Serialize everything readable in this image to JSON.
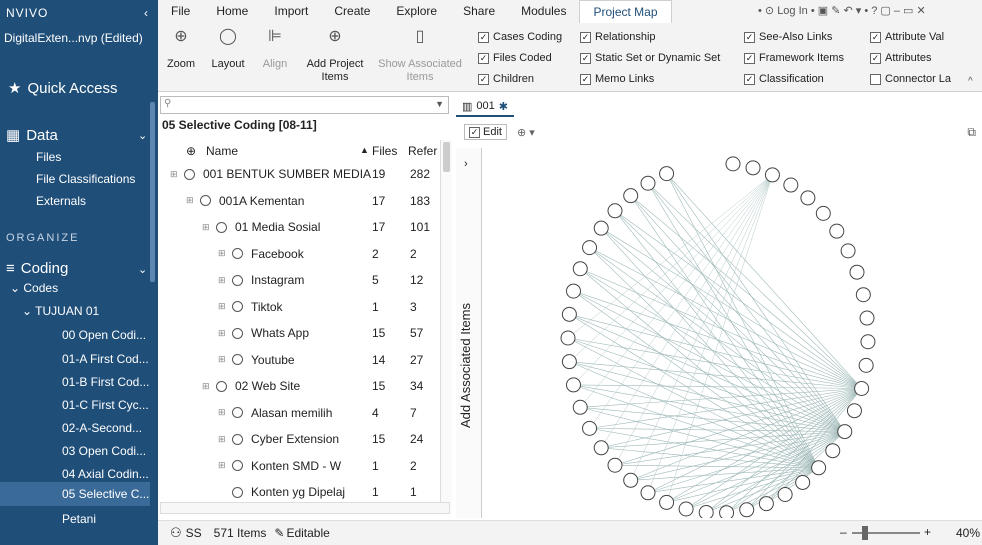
{
  "sidebar": {
    "logo": "NVIVO",
    "project": "DigitalExten...nvp (Edited)",
    "quick_access": "Quick Access",
    "data_header": "Data",
    "data_items": [
      "Files",
      "File Classifications",
      "Externals"
    ],
    "organize_label": "ORGANIZE",
    "coding_header": "Coding",
    "codes_label": "Codes",
    "tujuan_label": "TUJUAN 01",
    "code_items": [
      "00 Open Codi...",
      "01-A First Cod...",
      "01-B First Cod...",
      "01-C First Cyc...",
      "02-A-Second...",
      "03 Open Codi...",
      "04 Axial Codin...",
      "05 Selective C...",
      "Petani"
    ]
  },
  "ribbon": {
    "tabs": [
      "File",
      "Home",
      "Import",
      "Create",
      "Explore",
      "Share",
      "Modules",
      "Project Map"
    ],
    "active_tab": "Project Map",
    "log_in": "Log In",
    "tools": [
      {
        "label": "Zoom"
      },
      {
        "label": "Layout"
      },
      {
        "label": "Align"
      },
      {
        "label": "Add Project Items"
      },
      {
        "label": "Show Associated Items"
      }
    ],
    "checks": [
      {
        "label": "Cases Coding",
        "checked": true
      },
      {
        "label": "Files Coded",
        "checked": true
      },
      {
        "label": "Children",
        "checked": true
      },
      {
        "label": "Relationship",
        "checked": true
      },
      {
        "label": "Static Set or Dynamic Set",
        "checked": true
      },
      {
        "label": "Memo Links",
        "checked": true
      },
      {
        "label": "See-Also Links",
        "checked": true
      },
      {
        "label": "Framework Items",
        "checked": true
      },
      {
        "label": "Classification",
        "checked": true
      },
      {
        "label": "Attribute Val",
        "checked": true
      },
      {
        "label": "Attributes",
        "checked": true
      },
      {
        "label": "Connector La",
        "checked": false
      }
    ]
  },
  "list": {
    "folder_title": "05 Selective Coding [08-11]",
    "col_name": "Name",
    "col_files": "Files",
    "col_refs": "Refer",
    "rows": [
      {
        "name": "001 BENTUK SUMBER MEDIA",
        "files": "19",
        "refs": "282",
        "level": 0
      },
      {
        "name": "001A Kementan",
        "files": "17",
        "refs": "183",
        "level": 1
      },
      {
        "name": "01 Media Sosial",
        "files": "17",
        "refs": "101",
        "level": 2
      },
      {
        "name": "Facebook",
        "files": "2",
        "refs": "2",
        "level": 3
      },
      {
        "name": "Instagram",
        "files": "5",
        "refs": "12",
        "level": 3
      },
      {
        "name": "Tiktok",
        "files": "1",
        "refs": "3",
        "level": 3
      },
      {
        "name": "Whats App",
        "files": "15",
        "refs": "57",
        "level": 3
      },
      {
        "name": "Youtube",
        "files": "14",
        "refs": "27",
        "level": 3
      },
      {
        "name": "02 Web Site",
        "files": "15",
        "refs": "34",
        "level": 2
      },
      {
        "name": "Alasan memilih",
        "files": "4",
        "refs": "7",
        "level": 3
      },
      {
        "name": "Cyber Extension",
        "files": "15",
        "refs": "24",
        "level": 3
      },
      {
        "name": "Konten SMD - W",
        "files": "1",
        "refs": "2",
        "level": 3
      },
      {
        "name": "Konten yg Dipelaj",
        "files": "1",
        "refs": "1",
        "level": 3
      }
    ]
  },
  "map": {
    "tab_label": "001",
    "edit_label": "Edit",
    "add_associated": "Add Associated Items"
  },
  "status": {
    "user": "SS",
    "items": "571 Items",
    "editable": "Editable",
    "zoom": "40%"
  },
  "colors": {
    "sidebar_bg": "#1f4e79",
    "accent": "#1f4e79",
    "selected": "#3a6a98"
  }
}
